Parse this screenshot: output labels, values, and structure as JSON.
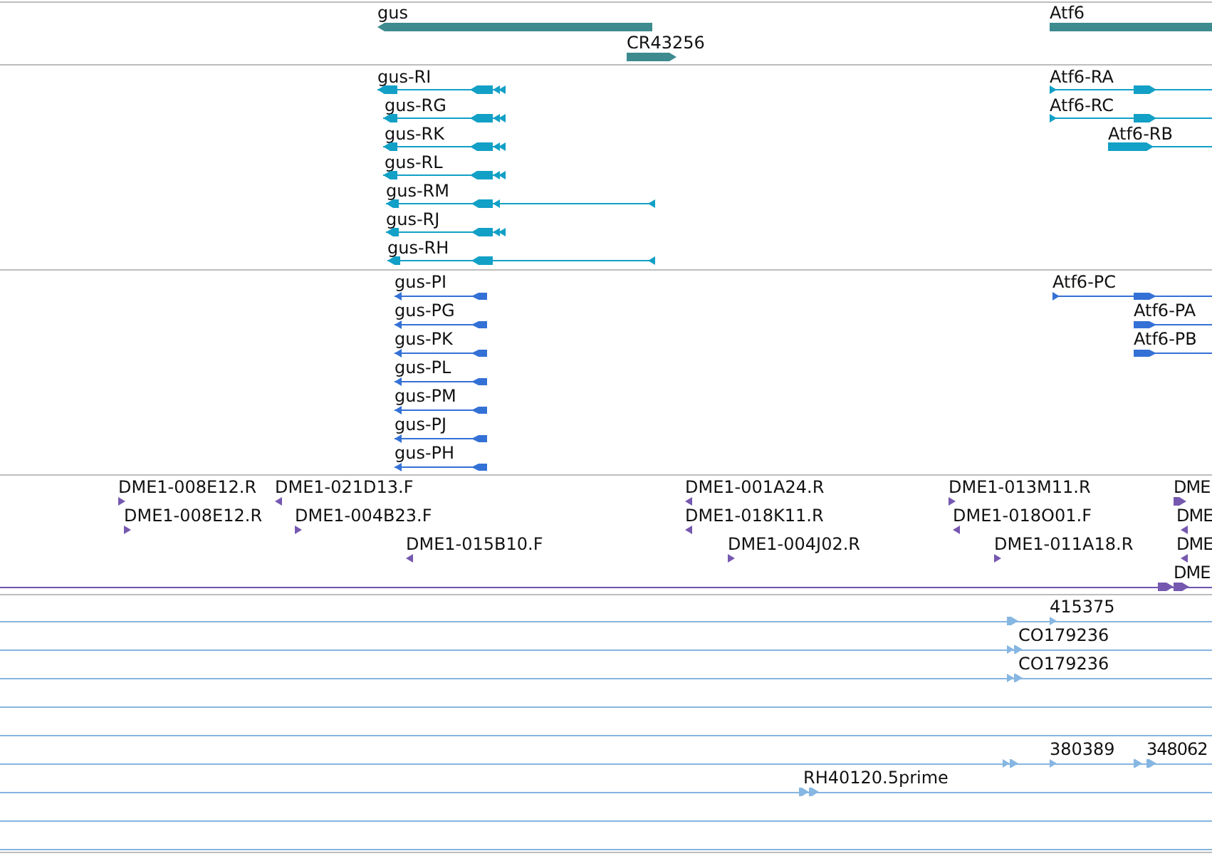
{
  "tracks": [
    {
      "kind": "gene",
      "features": [
        {
          "label": "gus",
          "reverse": true
        },
        {
          "label": "CR43256",
          "reverse": false
        },
        {
          "label": "Atf6",
          "reverse": false
        }
      ]
    },
    {
      "kind": "transcript",
      "features": [
        {
          "label": "gus-RI",
          "reverse": true
        },
        {
          "label": "gus-RG",
          "reverse": true
        },
        {
          "label": "gus-RK",
          "reverse": true
        },
        {
          "label": "gus-RL",
          "reverse": true
        },
        {
          "label": "gus-RM",
          "reverse": true
        },
        {
          "label": "gus-RJ",
          "reverse": true
        },
        {
          "label": "gus-RH",
          "reverse": true
        },
        {
          "label": "Atf6-RA",
          "reverse": false
        },
        {
          "label": "Atf6-RC",
          "reverse": false
        },
        {
          "label": "Atf6-RB",
          "reverse": false
        }
      ]
    },
    {
      "kind": "protein",
      "features": [
        {
          "label": "gus-PI",
          "reverse": true
        },
        {
          "label": "gus-PG",
          "reverse": true
        },
        {
          "label": "gus-PK",
          "reverse": true
        },
        {
          "label": "gus-PL",
          "reverse": true
        },
        {
          "label": "gus-PM",
          "reverse": true
        },
        {
          "label": "gus-PJ",
          "reverse": true
        },
        {
          "label": "gus-PH",
          "reverse": true
        },
        {
          "label": "Atf6-PC",
          "reverse": false
        },
        {
          "label": "Atf6-PA",
          "reverse": false
        },
        {
          "label": "Atf6-PB",
          "reverse": false
        }
      ]
    },
    {
      "kind": "clone_end",
      "features": [
        {
          "label": "DME1-008E12.R",
          "reverse": false
        },
        {
          "label": "DME1-021D13.F",
          "reverse": true
        },
        {
          "label": "DME1-001A24.R",
          "reverse": true
        },
        {
          "label": "DME1-013M11.R",
          "reverse": false
        },
        {
          "label": "DME",
          "reverse": false
        },
        {
          "label": "DME1-008E12.R",
          "reverse": false
        },
        {
          "label": "DME1-004B23.F",
          "reverse": false
        },
        {
          "label": "DME1-018K11.R",
          "reverse": true
        },
        {
          "label": "DME1-018O01.F",
          "reverse": true
        },
        {
          "label": "DME",
          "reverse": true
        },
        {
          "label": "DME1-015B10.F",
          "reverse": true
        },
        {
          "label": "DME1-004J02.R",
          "reverse": false
        },
        {
          "label": "DME1-011A18.R",
          "reverse": false
        },
        {
          "label": "DME",
          "reverse": true
        },
        {
          "label": "DME",
          "reverse": false
        }
      ]
    },
    {
      "kind": "est",
      "features": [
        {
          "reverse": false
        },
        {
          "label": "415375",
          "reverse": false
        },
        {
          "label": "CO179236",
          "reverse": false
        },
        {
          "label": "CO179236",
          "reverse": false
        },
        {
          "reverse": false
        },
        {
          "label": "380389",
          "reverse": false
        },
        {
          "label": "348062",
          "reverse": false
        },
        {
          "label": "RH40120.5prime",
          "reverse": false
        }
      ]
    }
  ]
}
